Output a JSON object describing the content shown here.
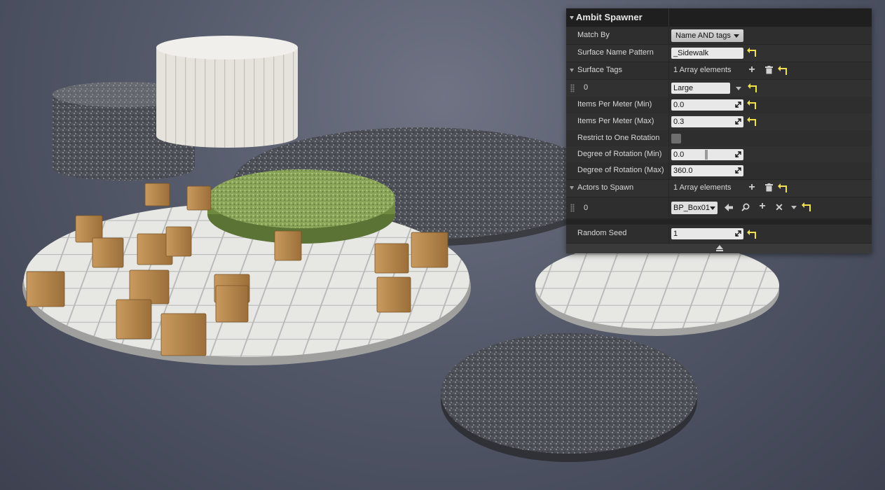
{
  "panel": {
    "title": "Ambit Spawner",
    "match_by": {
      "label": "Match By",
      "value": "Name AND tags"
    },
    "surface_name_pattern": {
      "label": "Surface Name Pattern",
      "value": "_Sidewalk"
    },
    "surface_tags": {
      "label": "Surface Tags",
      "summary": "1 Array elements",
      "items": [
        {
          "index": "0",
          "value": "Large"
        }
      ]
    },
    "items_per_meter_min": {
      "label": "Items Per Meter (Min)",
      "value": "0.0"
    },
    "items_per_meter_max": {
      "label": "Items Per Meter (Max)",
      "value": "0.3"
    },
    "restrict_rotation": {
      "label": "Restrict to One Rotation",
      "checked": false
    },
    "rotation_min": {
      "label": "Degree of Rotation (Min)",
      "value": "0.0"
    },
    "rotation_max": {
      "label": "Degree of Rotation (Max)",
      "value": "360.0"
    },
    "actors_to_spawn": {
      "label": "Actors to Spawn",
      "summary": "1 Array elements",
      "items": [
        {
          "index": "0",
          "value": "BP_Box01"
        }
      ]
    },
    "random_seed": {
      "label": "Random Seed",
      "value": "1"
    }
  },
  "icons": {
    "add": "plus-icon",
    "delete": "trash-icon",
    "reset": "reset-to-default-icon",
    "use_selected": "arrow-left-icon",
    "browse": "search-icon",
    "clear": "close-icon",
    "expand": "chevron-down-icon",
    "collapse_panel": "eject-icon"
  },
  "colors": {
    "panel_bg": "#2b2b2b",
    "reset_arrow": "#f0e24a",
    "viewport_bg": "#5a5f70"
  }
}
